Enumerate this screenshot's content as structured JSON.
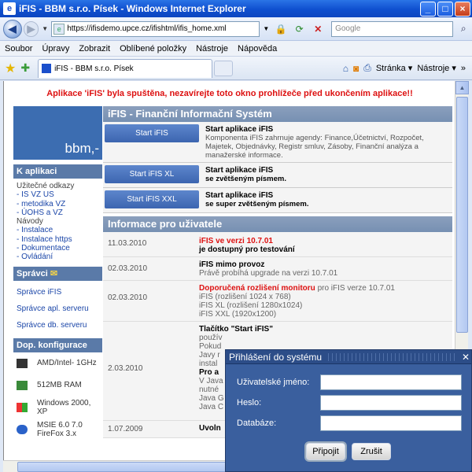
{
  "window": {
    "title": "iFIS - BBM s.r.o. Písek - Windows Internet Explorer"
  },
  "address": {
    "url": "https://ifisdemo.upce.cz/ifishtml/ifis_home.xml",
    "search_placeholder": "Google"
  },
  "menu": [
    "Soubor",
    "Úpravy",
    "Zobrazit",
    "Oblíbené položky",
    "Nástroje",
    "Nápověda"
  ],
  "tab": {
    "label": "iFIS - BBM s.r.o. Písek"
  },
  "tools": {
    "page": "Stránka",
    "tools": "Nástroje"
  },
  "page": {
    "notice": "Aplikace 'iFIS' byla spuštěna, nezavírejte toto okno prohlížeče před ukončením aplikace!!",
    "logo": "bbm,-",
    "sidebar": {
      "apps_title": "K aplikaci",
      "links_heading": "Užitečné odkazy",
      "links": [
        "- IS VZ US",
        "- metodika VZ",
        "- ÚOHS a VZ"
      ],
      "guides_heading": "Návody",
      "guides": [
        "- Instalace",
        "- Instalace https",
        "- Dokumentace",
        "- Ovládání"
      ],
      "admins_title": "Správci",
      "admins": [
        "Správce iFIS",
        "Správce apl. serveru",
        "Správce db. serveru"
      ],
      "config_title": "Dop. konfigurace",
      "config": [
        "AMD/Intel- 1GHz",
        "512MB RAM",
        "Windows 2000, XP",
        "MSIE 6.0 7.0 FireFox 3.x"
      ]
    },
    "main_title": "iFIS - Finanční Informační Systém",
    "starts": [
      {
        "button": "Start iFIS",
        "title": "Start aplikace iFIS",
        "desc": "Komponenta iFIS zahrnuje agendy: Finance,Účetnictví, Rozpočet, Majetek, Objednávky, Registr smluv, Zásoby, Finanční analýza a manažerské informace."
      },
      {
        "button": "Start iFIS XL",
        "title": "Start aplikace iFIS",
        "desc": "se zvětšeným písmem."
      },
      {
        "button": "Start iFIS XXL",
        "title": "Start aplikace iFIS",
        "desc": "se super zvětšeným písmem."
      }
    ],
    "info_title": "Informace pro uživatele",
    "info": [
      {
        "date": "11.03.2010",
        "l1": "iFIS ve verzi 10.7.01",
        "l2": "je dostupný pro testování"
      },
      {
        "date": "02.03.2010",
        "l1": "iFIS mimo provoz",
        "l2": "Právě probíhá upgrade na verzi 10.7.01"
      },
      {
        "date": "02.03.2010",
        "l1": "Doporučená rozlišení monitoru",
        "l1b": " pro iFIS verze 10.7.01",
        "l2": "iFIS (rozlišení 1024 x 768)",
        "l3": "iFIS XL (rozlišení 1280x1024)",
        "l4": "iFIS XXL (1920x1200)"
      },
      {
        "date": "2.03.2010",
        "l1": "Tlačítko \"Start iFIS\"",
        "l2": "použív",
        "l3": "Pokud",
        "l4": "Javy r",
        "l5": "instal",
        "l6": "Pro a",
        "l7": "V Java",
        "l8": "nutné",
        "l9": "Java G",
        "l10": "Java C"
      },
      {
        "date": "1.07.2009",
        "l1": "Uvoln"
      }
    ]
  },
  "dialog": {
    "title": "Přihlášení do systému",
    "username_label": "Uživatelské jméno:",
    "password_label": "Heslo:",
    "database_label": "Databáze:",
    "connect": "Připojit",
    "cancel": "Zrušit"
  }
}
